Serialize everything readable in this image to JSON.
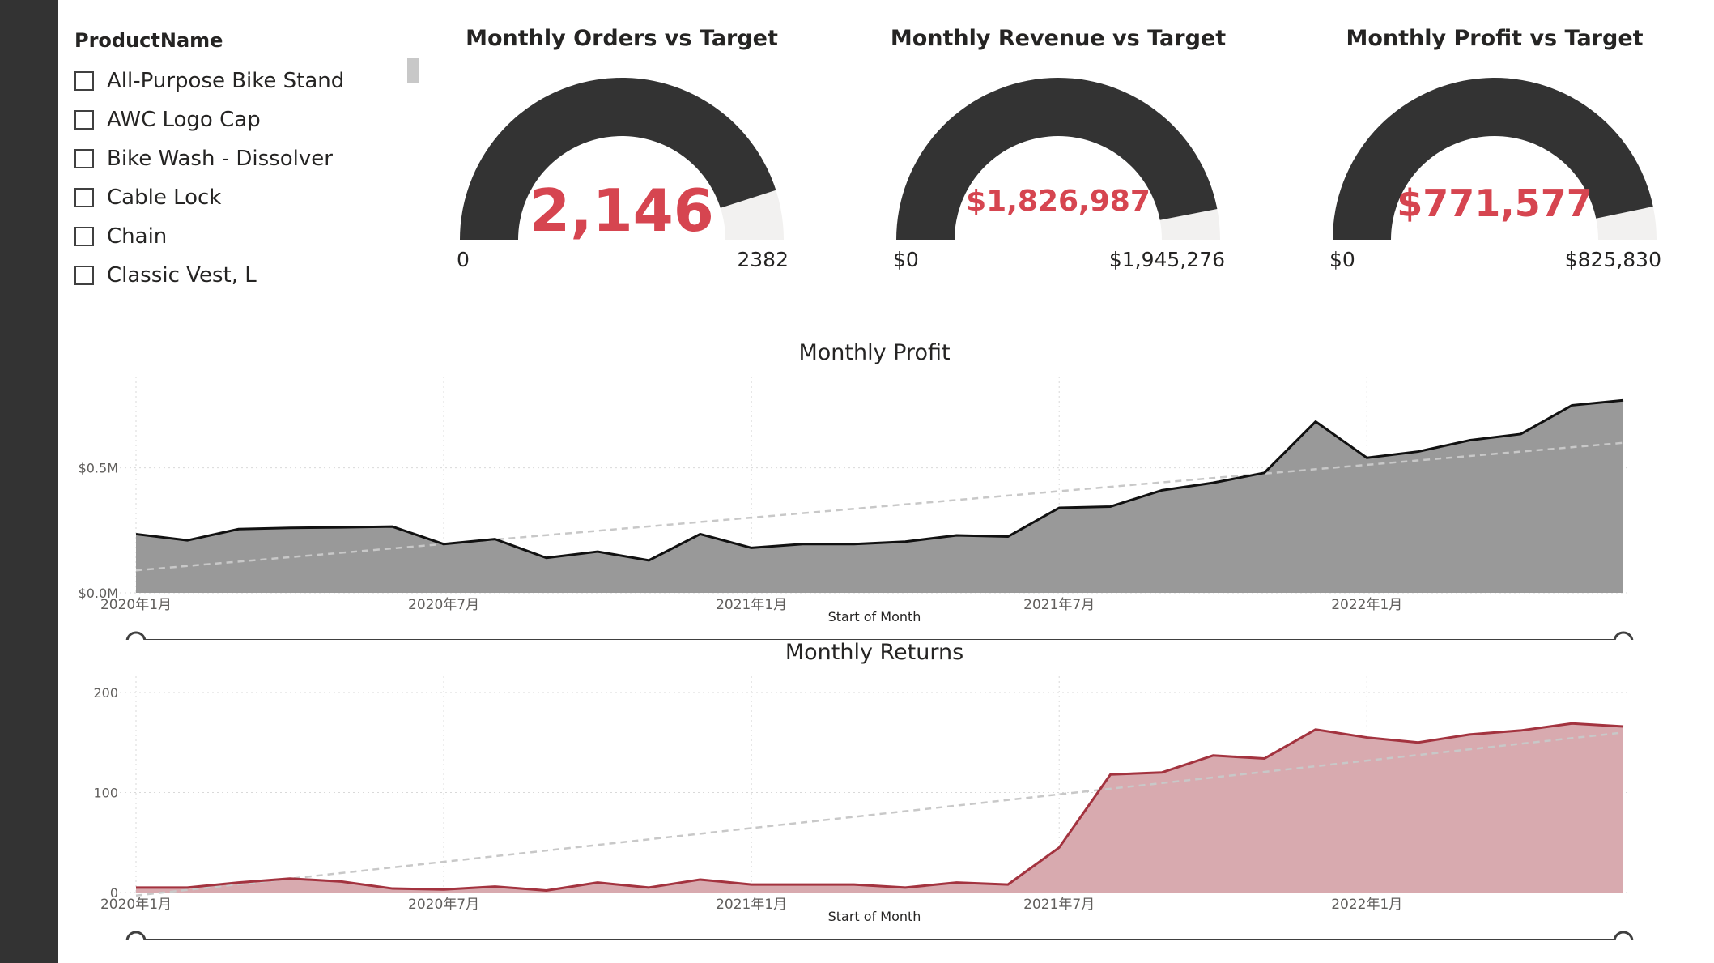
{
  "colors": {
    "sidebar": "#333333",
    "gauge_fill": "#333333",
    "gauge_track": "#f2f1f0",
    "value_accent": "#d64550",
    "profit_area": "#999999",
    "profit_line": "#111111",
    "returns_area": "#d8aaaf",
    "returns_line": "#a3333f",
    "trend_line": "#c8c8c8"
  },
  "slicer": {
    "title": "ProductName",
    "items": [
      {
        "label": "All-Purpose Bike Stand"
      },
      {
        "label": "AWC Logo Cap"
      },
      {
        "label": "Bike Wash - Dissolver"
      },
      {
        "label": "Cable Lock"
      },
      {
        "label": "Chain"
      },
      {
        "label": "Classic Vest, L"
      }
    ]
  },
  "gauges": [
    {
      "title": "Monthly Orders vs Target",
      "value": 2146,
      "display": "2,146",
      "min": 0,
      "max": 2382,
      "min_label": "0",
      "max_label": "2382"
    },
    {
      "title": "Monthly Revenue vs Target",
      "value": 1826987,
      "display": "$1,826,987",
      "min": 0,
      "max": 1945276,
      "min_label": "$0",
      "max_label": "$1,945,276"
    },
    {
      "title": "Monthly Profit vs Target",
      "value": 771577,
      "display": "$771,577",
      "min": 0,
      "max": 825830,
      "min_label": "$0",
      "max_label": "$825,830"
    }
  ],
  "chart_data": [
    {
      "type": "area",
      "title": "Monthly Profit",
      "xlabel": "Start of Month",
      "ylabel": "",
      "x": [
        "2020-01",
        "2020-02",
        "2020-03",
        "2020-04",
        "2020-05",
        "2020-06",
        "2020-07",
        "2020-08",
        "2020-09",
        "2020-10",
        "2020-11",
        "2020-12",
        "2021-01",
        "2021-02",
        "2021-03",
        "2021-04",
        "2021-05",
        "2021-06",
        "2021-07",
        "2021-08",
        "2021-09",
        "2021-10",
        "2021-11",
        "2021-12",
        "2022-01",
        "2022-02",
        "2022-03",
        "2022-04",
        "2022-05",
        "2022-06"
      ],
      "x_tick_labels": [
        "2020年1月",
        "2020年7月",
        "2021年1月",
        "2021年7月",
        "2022年1月"
      ],
      "y_tick_labels": [
        "$0.0M",
        "$0.5M"
      ],
      "y_ticks": [
        0,
        0.5
      ],
      "ylim": [
        0,
        0.8
      ],
      "series": [
        {
          "values": [
            0.235,
            0.21,
            0.255,
            0.26,
            0.262,
            0.265,
            0.195,
            0.215,
            0.14,
            0.165,
            0.13,
            0.235,
            0.18,
            0.195,
            0.195,
            0.205,
            0.23,
            0.225,
            0.34,
            0.345,
            0.41,
            0.44,
            0.48,
            0.685,
            0.54,
            0.565,
            0.61,
            0.635,
            0.75,
            0.77
          ]
        }
      ],
      "trend": [
        0.09,
        0.6
      ],
      "grid": true
    },
    {
      "type": "area",
      "title": "Monthly Returns",
      "xlabel": "Start of Month",
      "ylabel": "",
      "x": [
        "2020-01",
        "2020-02",
        "2020-03",
        "2020-04",
        "2020-05",
        "2020-06",
        "2020-07",
        "2020-08",
        "2020-09",
        "2020-10",
        "2020-11",
        "2020-12",
        "2021-01",
        "2021-02",
        "2021-03",
        "2021-04",
        "2021-05",
        "2021-06",
        "2021-07",
        "2021-08",
        "2021-09",
        "2021-10",
        "2021-11",
        "2021-12",
        "2022-01",
        "2022-02",
        "2022-03",
        "2022-04",
        "2022-05",
        "2022-06"
      ],
      "x_tick_labels": [
        "2020年1月",
        "2020年7月",
        "2021年1月",
        "2021年7月",
        "2022年1月"
      ],
      "y_tick_labels": [
        "0",
        "100",
        "200"
      ],
      "y_ticks": [
        0,
        100,
        200
      ],
      "ylim": [
        0,
        200
      ],
      "series": [
        {
          "values": [
            5,
            5,
            10,
            14,
            11,
            4,
            3,
            6,
            2,
            10,
            5,
            13,
            8,
            8,
            8,
            5,
            10,
            8,
            45,
            118,
            120,
            137,
            134,
            163,
            155,
            150,
            158,
            162,
            169,
            166
          ]
        }
      ],
      "trend": [
        -3,
        160
      ],
      "grid": true
    }
  ]
}
